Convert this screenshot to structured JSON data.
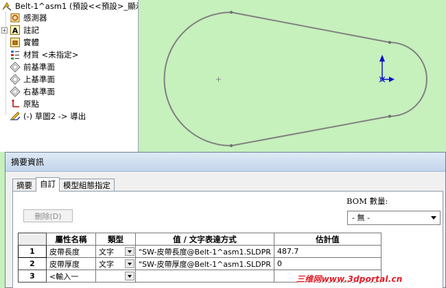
{
  "tree": {
    "root_label": "Belt-1^asm1  (預設<<預設>_顯示",
    "items": [
      {
        "label": "感測器",
        "icon": "sensor-icon"
      },
      {
        "label": "註記",
        "icon": "annotation-icon"
      },
      {
        "label": "實體",
        "icon": "solid-bodies-icon"
      },
      {
        "label": "材質 <未指定>",
        "icon": "material-icon"
      },
      {
        "label": "前基準面",
        "icon": "plane-icon"
      },
      {
        "label": "上基準面",
        "icon": "plane-icon"
      },
      {
        "label": "右基準面",
        "icon": "plane-icon"
      },
      {
        "label": "原點",
        "icon": "origin-icon"
      },
      {
        "label": "(-) 草圖2 -> 導出",
        "icon": "sketch-icon"
      }
    ]
  },
  "dialog": {
    "title": "摘要資訊",
    "tabs": [
      "摘要",
      "自訂",
      "模型組態指定"
    ],
    "active_tab": "自訂",
    "delete_button": "刪除(D)",
    "bom_label": "BOM 數量:",
    "bom_value": "- 無 -",
    "table": {
      "headers": [
        "屬性名稱",
        "類型",
        "值 / 文字表達方式",
        "估計值"
      ],
      "rows": [
        {
          "num": "1",
          "name": "皮帶長度",
          "type": "文字",
          "value": "\"SW-皮帶長度@Belt-1^asm1.SLDPR",
          "evaluated": "487.7"
        },
        {
          "num": "2",
          "name": "皮帶厚度",
          "type": "文字",
          "value": "\"SW-皮帶厚度@Belt-1^asm1.SLDPR",
          "evaluated": "0"
        },
        {
          "num": "3",
          "name": "<輸入一",
          "type": "",
          "value": "",
          "evaluated": ""
        }
      ]
    }
  },
  "watermark": "三维网www.3dportal.cn",
  "colors": {
    "viewport_bg": "#c6f0bc",
    "sketch_line": "#808080",
    "axis_blue": "#1010c8",
    "watermark_red": "#e21b24"
  }
}
